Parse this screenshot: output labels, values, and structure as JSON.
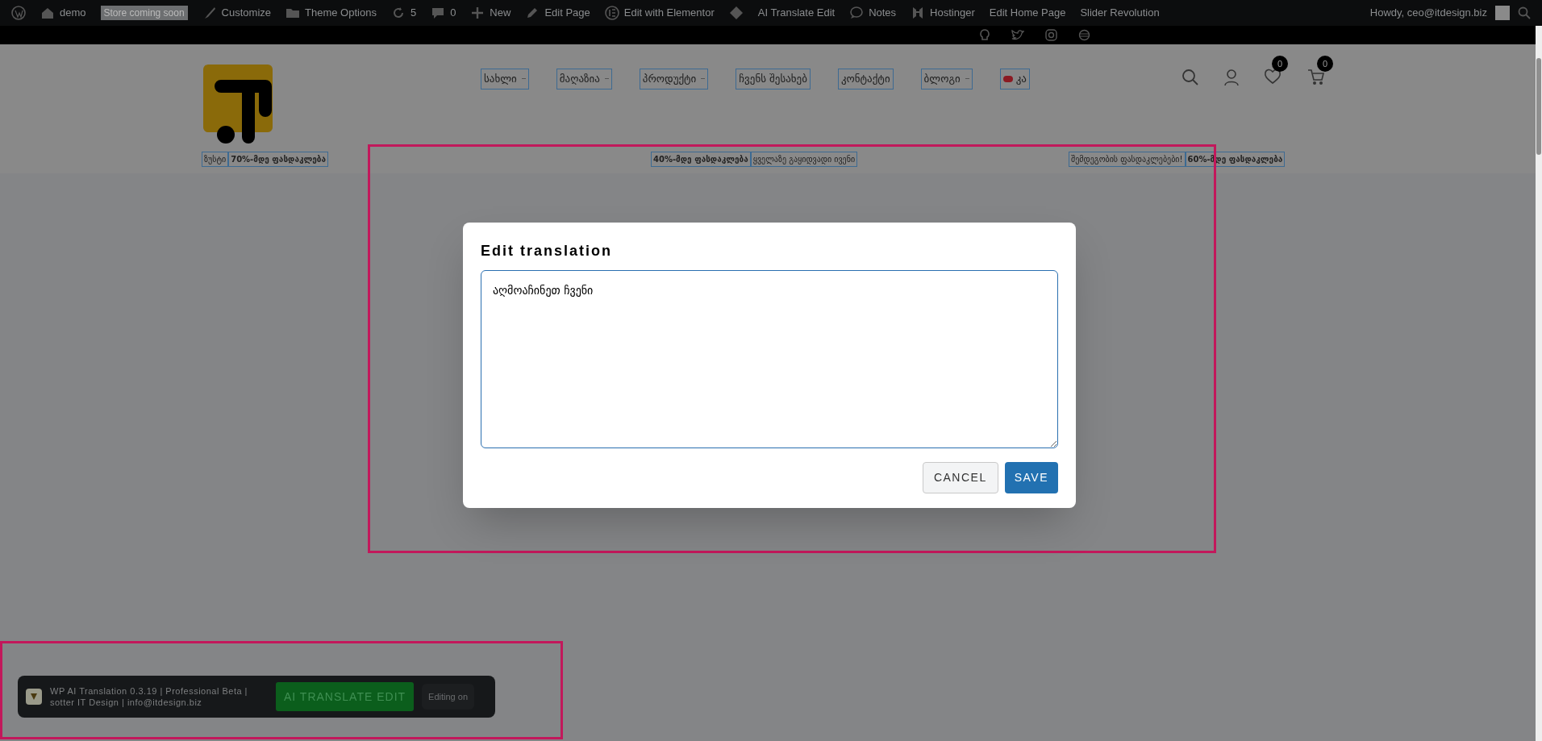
{
  "admin_bar": {
    "left": [
      {
        "kind": "logo"
      },
      {
        "kind": "site",
        "label": "demo"
      },
      {
        "kind": "badge",
        "label": "Store coming soon"
      },
      {
        "kind": "brush",
        "label": "Customize"
      },
      {
        "kind": "folder",
        "label": "Theme Options"
      },
      {
        "kind": "updates",
        "label": "5"
      },
      {
        "kind": "comments",
        "label": "0"
      },
      {
        "kind": "plus",
        "label": "New"
      },
      {
        "kind": "pencil",
        "label": "Edit Page"
      },
      {
        "kind": "elementor",
        "label": "Edit with Elementor"
      },
      {
        "kind": "diamond"
      },
      {
        "kind": "text",
        "label": "AI Translate Edit"
      },
      {
        "kind": "bubble",
        "label": "Notes"
      },
      {
        "kind": "hostinger",
        "label": "Hostinger"
      },
      {
        "kind": "text",
        "label": "Edit Home Page"
      },
      {
        "kind": "text",
        "label": "Slider Revolution"
      }
    ],
    "greeting": "Howdy, ceo@itdesign.biz"
  },
  "header": {
    "main_nav": [
      {
        "label": "სახლი",
        "dropdown": true
      },
      {
        "label": "მაღაზია",
        "dropdown": true
      },
      {
        "label": "პროდუქტი",
        "dropdown": true
      },
      {
        "label": "ჩვენს შესახებ",
        "dropdown": false
      },
      {
        "label": "კონტაქტი",
        "dropdown": false
      },
      {
        "label": "ბლოგი",
        "dropdown": true
      },
      {
        "label": "კა",
        "dropdown": false,
        "flag": true
      }
    ],
    "wishlist_count": "0",
    "cart_count": "0",
    "promo_nav": [
      "ზუსტი",
      "70%-მდე ფასდაკლება",
      "40%-მდე ფასდაკლება",
      "ყველაზე გაყიდვადი ივენი",
      "შემდეგობის ფასდაკლებები!",
      "60%-მდე ფასდაკლება"
    ]
  },
  "dialog": {
    "title": "Edit translation",
    "value": "აღმოაჩინეთ ჩვენი ",
    "buttons": [
      {
        "kind": "secondary",
        "label": "CANCEL"
      },
      {
        "kind": "primary",
        "label": "SAVE"
      }
    ]
  },
  "translate_bar": {
    "info": "WP AI Translation 0.3.19 | Professional Beta | sotter IT Design | info@itdesign.biz",
    "button": "AI TRANSLATE EDIT",
    "toggle": "Editing on"
  }
}
